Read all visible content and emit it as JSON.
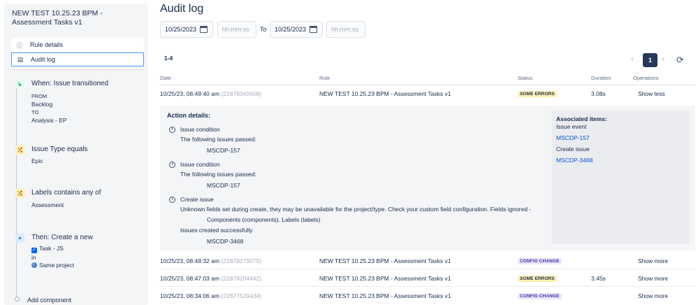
{
  "sidebar": {
    "title": "NEW TEST 10.25.23 BPM - Assessment Tasks v1",
    "items": [
      {
        "label": "Rule details",
        "icon": "info-icon"
      },
      {
        "label": "Audit log",
        "icon": "document-icon"
      }
    ],
    "trigger": {
      "label": "When: Issue transitioned",
      "from_label": "FROM",
      "from_value": "Backlog",
      "to_label": "TO",
      "to_value": "Analysis - EP"
    },
    "condition1": {
      "label": "Issue Type equals",
      "value": "Epic"
    },
    "condition2": {
      "label": "Labels contains any of",
      "value": "Assessment"
    },
    "action": {
      "label": "Then: Create a new",
      "issue_type": "Task - JS",
      "in_label": "in",
      "project": "Same project"
    },
    "add_component": "Add component"
  },
  "main": {
    "title": "Audit log",
    "filters": {
      "from_date": "10/25/2023",
      "from_time_placeholder": "hh:mm:ss",
      "to_label": "To",
      "to_date": "10/25/2023",
      "to_time_placeholder": "hh:mm:ss"
    },
    "range": "1-4",
    "pagination": {
      "current": "1"
    },
    "columns": {
      "date": "Date",
      "rule": "Rule",
      "status": "Status",
      "duration": "Duration",
      "operations": "Operations"
    },
    "rows": [
      {
        "date": "10/25/23, 08:49:40 am",
        "id": "(22878340658)",
        "rule": "NEW TEST 10.25.23 BPM - Assessment Tasks v1",
        "status": "SOME ERRORS",
        "duration": "3.08s",
        "operation": "Show less"
      },
      {
        "date": "10/25/23, 08:48:32 am",
        "id": "(22878279075)",
        "rule": "NEW TEST 10.25.23 BPM - Assessment Tasks v1",
        "status": "CONFIG CHANGE",
        "duration": "",
        "operation": "Show more"
      },
      {
        "date": "10/25/23, 08:47:03 am",
        "id": "(22878204442)",
        "rule": "NEW TEST 10.25.23 BPM - Assessment Tasks v1",
        "status": "SOME ERRORS",
        "duration": "3.45s",
        "operation": "Show more"
      },
      {
        "date": "10/25/23, 08:34:06 am",
        "id": "(22877529434)",
        "rule": "NEW TEST 10.25.23 BPM - Assessment Tasks v1",
        "status": "CONFIG CHANGE",
        "duration": "",
        "operation": "Show more"
      }
    ],
    "details": {
      "title": "Action details:",
      "entries": [
        {
          "heading": "Issue condition",
          "line1": "The following issues passed:",
          "line2": "MSCDP-157"
        },
        {
          "heading": "Issue condition",
          "line1": "The following issues passed:",
          "line2": "MSCDP-157"
        },
        {
          "heading": "Create issue",
          "line1": "Unknown fields set during create, they may be unavailable for the project/type. Check your custom field configuration. Fields ignored -",
          "line2": "Components (components). Labels (labels)",
          "line3": "Issues created successfully",
          "line4": "MSCDP-3468"
        }
      ],
      "associated": {
        "title": "Associated items:",
        "event_label": "Issue event",
        "event_issue": "MSCDP-157",
        "create_label": "Create issue",
        "create_issue": "MSCDP-3468"
      }
    }
  }
}
